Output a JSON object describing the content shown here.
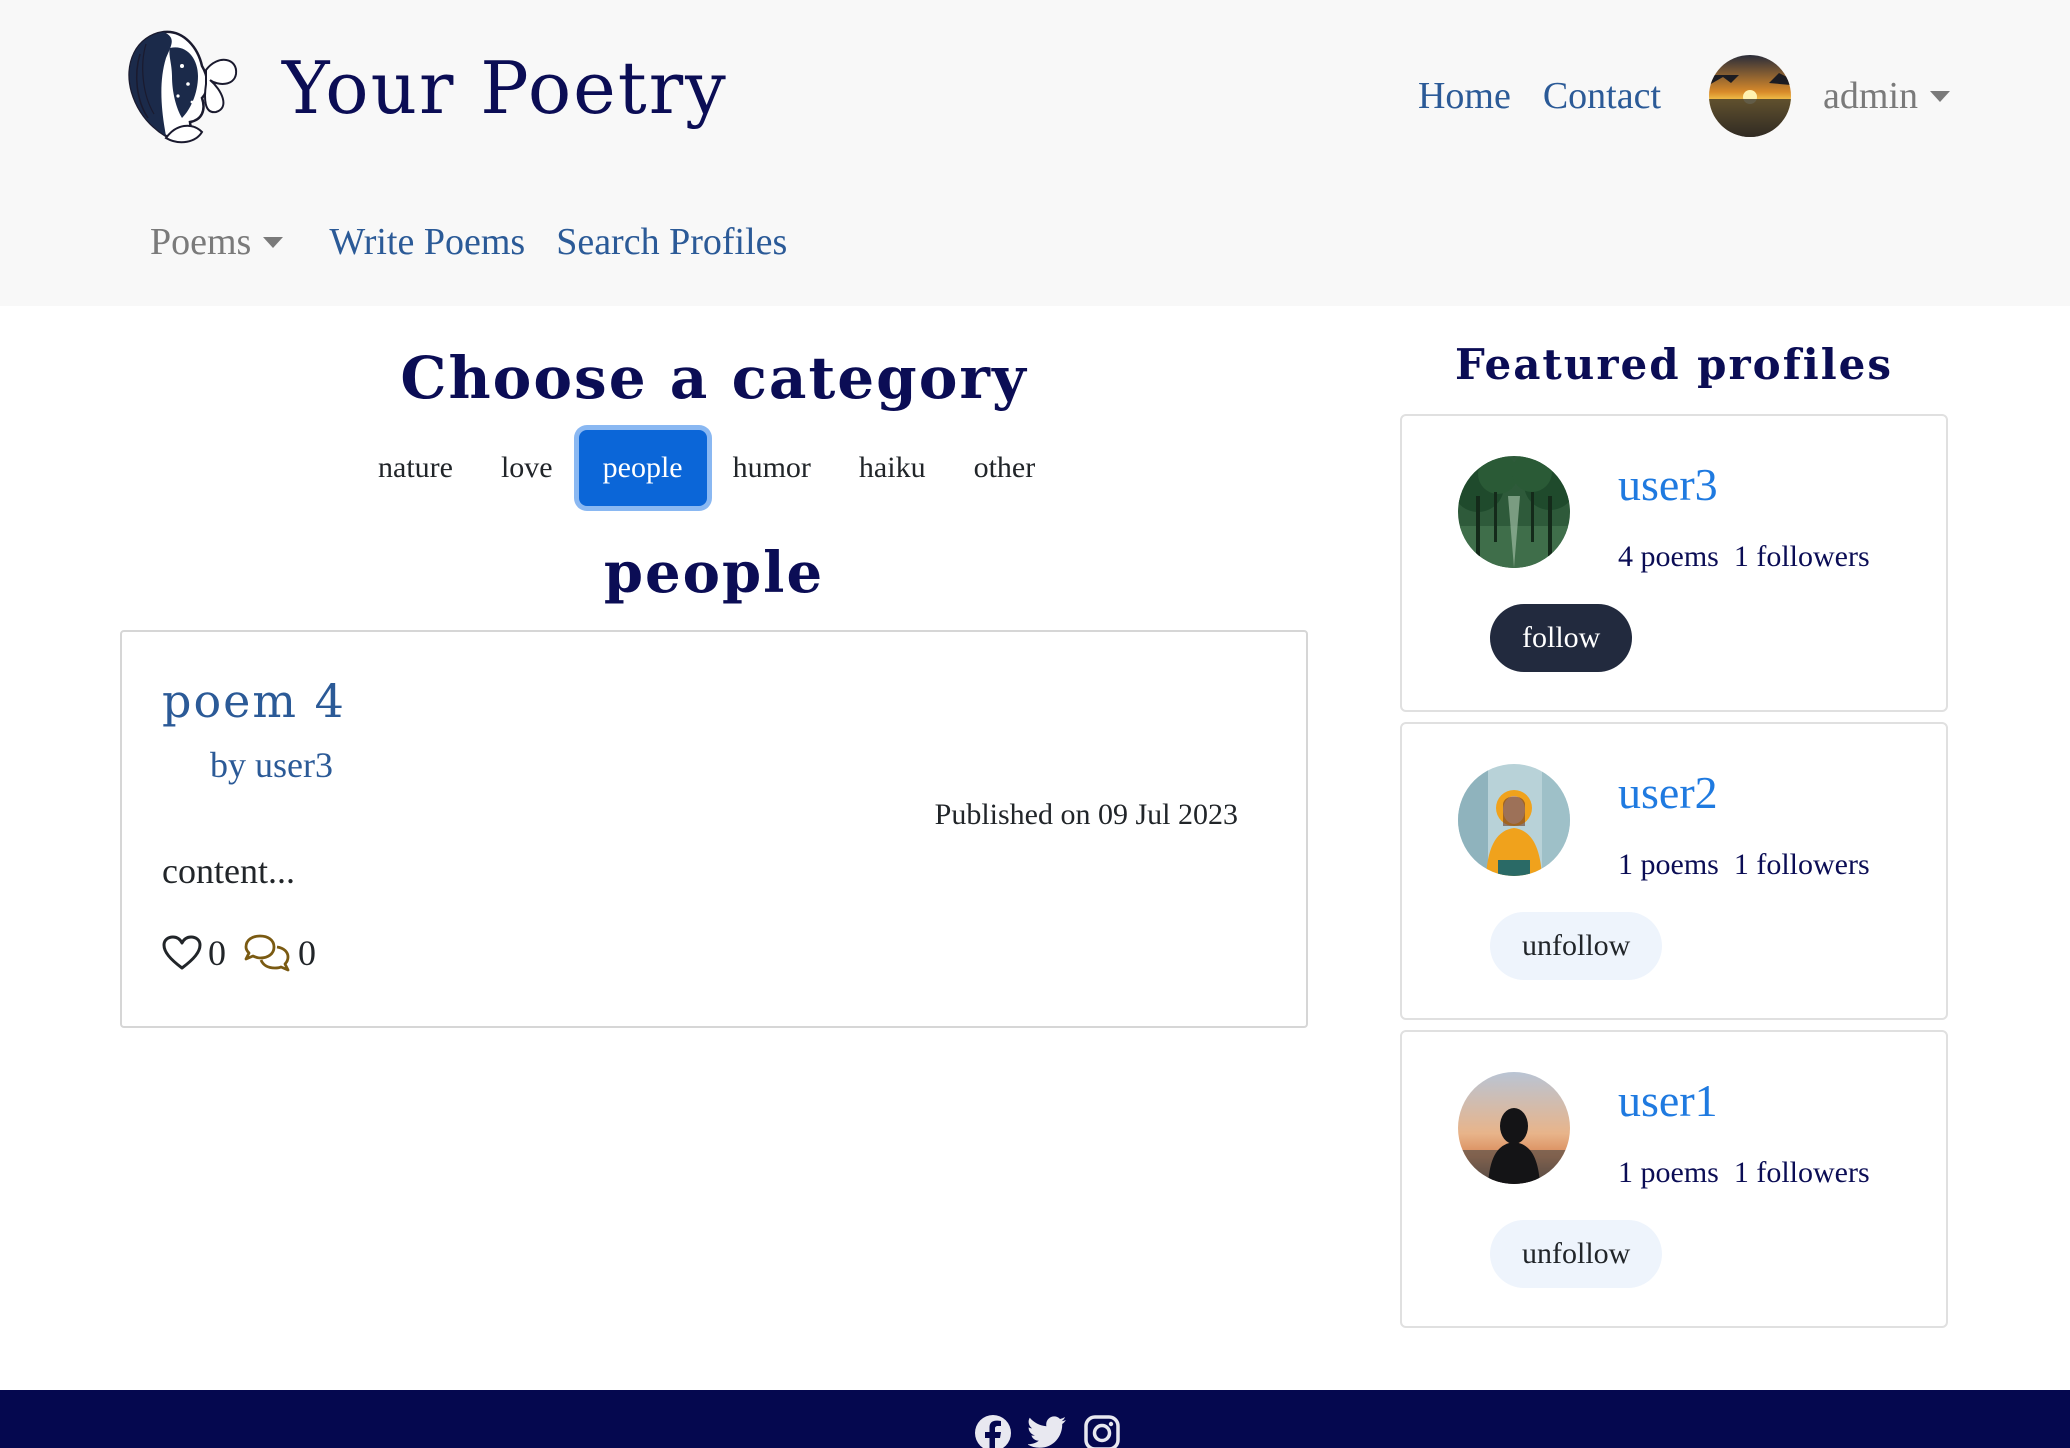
{
  "brand": {
    "title": "Your Poetry",
    "logo_icon": "woman-butterfly-logo"
  },
  "nav": {
    "home": "Home",
    "contact": "Contact",
    "user": "admin",
    "avatar_icon": "sunset-avatar",
    "poems_dropdown": "Poems",
    "write_poems": "Write Poems",
    "search_profiles": "Search Profiles"
  },
  "categories": {
    "title": "Choose a category",
    "items": [
      "nature",
      "love",
      "people",
      "humor",
      "haiku",
      "other"
    ],
    "selected": "people"
  },
  "poems": [
    {
      "title": "poem 4",
      "author": "by user3",
      "published": "Published on 09 Jul 2023",
      "excerpt": "content...",
      "likes": "0",
      "comments": "0"
    }
  ],
  "featured": {
    "title": "Featured profiles",
    "profiles": [
      {
        "name": "user3",
        "stats": "4 poems  1 followers",
        "button": "follow",
        "avatar_icon": "trees-avatar"
      },
      {
        "name": "user2",
        "stats": "1 poems  1 followers",
        "button": "unfollow",
        "avatar_icon": "yellow-hoodie-avatar"
      },
      {
        "name": "user1",
        "stats": "1 poems  1 followers",
        "button": "unfollow",
        "avatar_icon": "silhouette-avatar"
      }
    ]
  },
  "footer": {
    "icons": [
      "facebook-icon",
      "twitter-icon",
      "instagram-icon"
    ]
  },
  "colors": {
    "navy": "#0b0d55",
    "link": "#2b5a97",
    "active_category": "#0b66d8",
    "profile_link": "#1f7ae0",
    "footer": "#05084f"
  }
}
